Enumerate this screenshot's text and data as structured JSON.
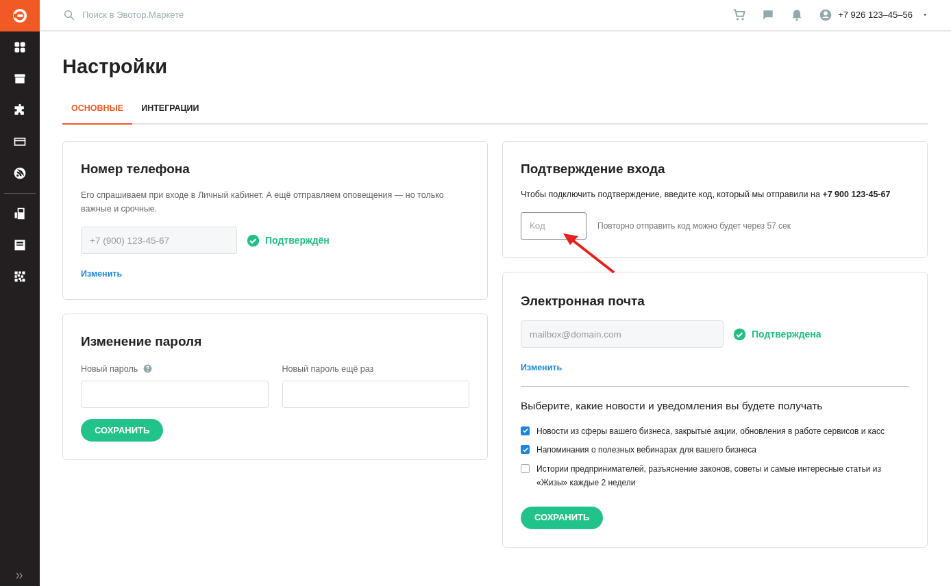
{
  "search": {
    "placeholder": "Поиск в Эвотор.Маркете"
  },
  "user": {
    "phone": "+7 926 123–45–56"
  },
  "page_title": "Настройки",
  "tabs": [
    {
      "label": "ОСНОВНЫЕ",
      "selected": true
    },
    {
      "label": "ИНТЕГРАЦИИ",
      "selected": false
    }
  ],
  "phone_card": {
    "title": "Номер телефона",
    "description": "Его спрашиваем при входе в Личный кабинет. А ещё отправляем оповещения — но только важные и срочные.",
    "field": {
      "value": "+7 (900) 123-45-67",
      "disabled": true
    },
    "verified": true,
    "status": "Подтверждён",
    "change_link": "Изменить"
  },
  "password_card": {
    "title": "Изменение пароля",
    "fields": [
      {
        "label": "Новый пароль",
        "help": true
      },
      {
        "label": "Новый пароль ещё раз",
        "help": false
      }
    ],
    "save_button": "СОХРАНИТЬ"
  },
  "login_confirmation_card": {
    "title": "Подтверждение входа",
    "instruction": "Чтобы подключить подтверждение, введите код, который мы отправили на **+7 900 123-45-67**",
    "code_field": {
      "placeholder": "Код"
    },
    "resend_note": "Повторно отправить код можно будет через 57 сек"
  },
  "email_card": {
    "title": "Электронная почта",
    "field": {
      "value": "mailbox@domain.com",
      "disabled": true
    },
    "verified": true,
    "status": "Подтверждена",
    "change_link": "Изменить",
    "subscriptions_title": "Выберите, какие новости и уведомления вы будете получать",
    "subscriptions": [
      {
        "label": "Новости из сферы вашего бизнеса, закрытые акции, обновления в работе сервисов и касс",
        "checked": true
      },
      {
        "label": "Напоминания о полезных вебинарах для вашего бизнеса",
        "checked": true
      },
      {
        "label": "Истории предпринимателей, разъяснение законов, советы и самые интересные статьи из «Жизы» каждые 2 недели",
        "checked": false
      }
    ],
    "save_button": "СОХРАНИТЬ"
  }
}
